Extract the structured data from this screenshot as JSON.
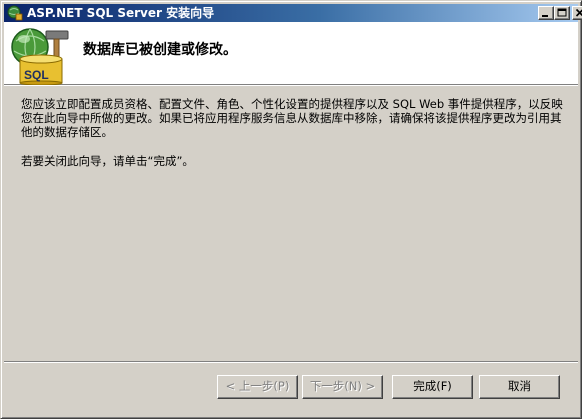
{
  "window": {
    "title": "ASP.NET SQL Server 安装向导",
    "icons": [
      "app-icon",
      "minimize-icon",
      "maximize-icon",
      "close-icon"
    ]
  },
  "header": {
    "title": "数据库已被创建或修改。",
    "icon": "database-tools-icon",
    "icon_label": "SQL"
  },
  "body": {
    "paragraph1": "您应该立即配置成员资格、配置文件、角色、个性化设置的提供程序以及 SQL Web 事件提供程序，以反映您在此向导中所做的更改。如果已将应用程序服务信息从数据库中移除，请确保将该提供程序更改为引用其他的数据存储区。",
    "paragraph2": "若要关闭此向导，请单击“完成”。"
  },
  "buttons": {
    "back": "< 上一步(P)",
    "next": "下一步(N) >",
    "finish": "完成(F)",
    "cancel": "取消"
  },
  "colors": {
    "titlebar_start": "#0a246a",
    "titlebar_end": "#a6caf0",
    "face": "#d4d0c8"
  }
}
